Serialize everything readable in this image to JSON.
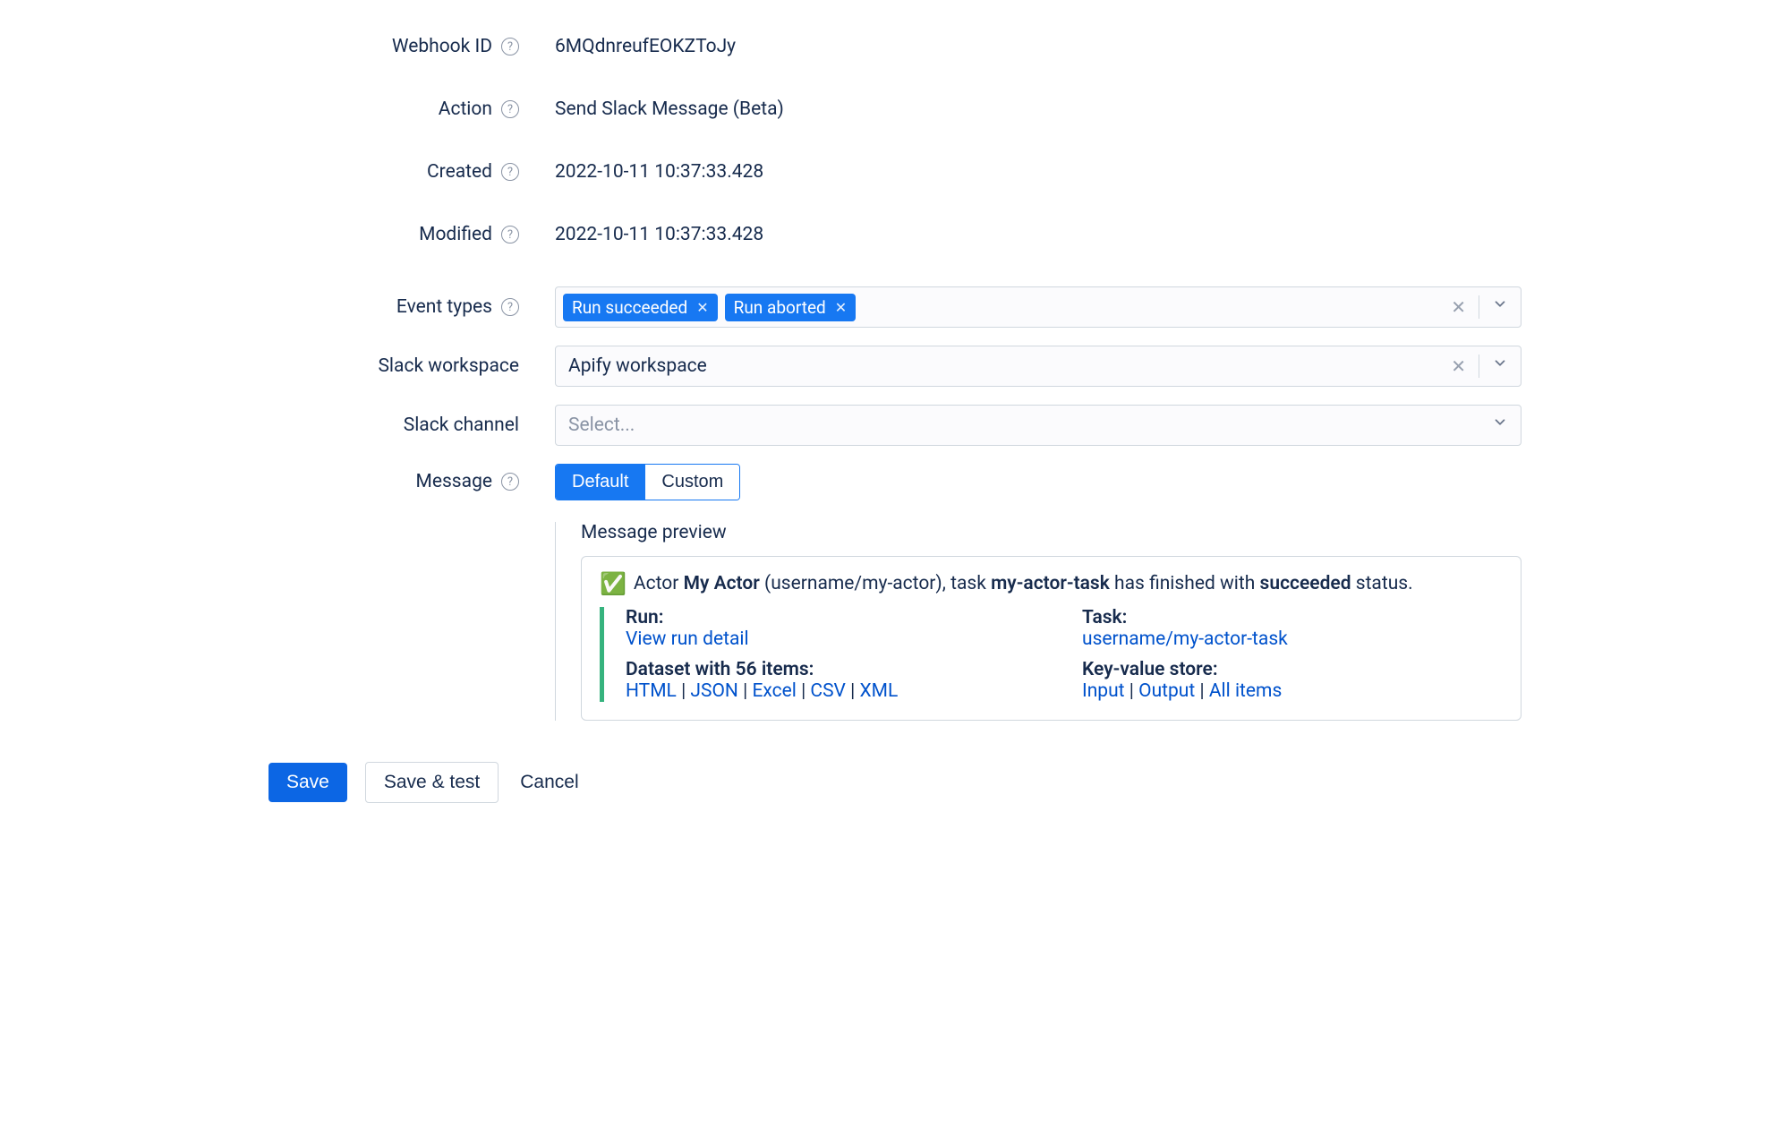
{
  "labels": {
    "webhook_id": "Webhook ID",
    "action": "Action",
    "created": "Created",
    "modified": "Modified",
    "event_types": "Event types",
    "slack_workspace": "Slack workspace",
    "slack_channel": "Slack channel",
    "message": "Message"
  },
  "values": {
    "webhook_id": "6MQdnreufEOKZToJy",
    "action": "Send Slack Message (Beta)",
    "created": "2022-10-11 10:37:33.428",
    "modified": "2022-10-11 10:37:33.428",
    "slack_workspace": "Apify workspace",
    "slack_channel_placeholder": "Select..."
  },
  "event_types": [
    {
      "label": "Run succeeded"
    },
    {
      "label": "Run aborted"
    }
  ],
  "message_toggle": {
    "default": "Default",
    "custom": "Custom",
    "active": "default"
  },
  "preview": {
    "title": "Message preview",
    "header": {
      "prefix": "Actor ",
      "actor_name": "My Actor",
      "actor_slug": " (username/my-actor), task ",
      "task_name": "my-actor-task",
      "mid": " has finished with ",
      "status": "succeeded",
      "suffix": " status."
    },
    "run_label": "Run:",
    "run_link": "View run detail",
    "dataset_label": "Dataset with 56 items:",
    "dataset_links": [
      "HTML",
      "JSON",
      "Excel",
      "CSV",
      "XML"
    ],
    "task_label": "Task:",
    "task_link": "username/my-actor-task",
    "kvs_label": "Key-value store:",
    "kvs_links": [
      "Input",
      "Output",
      "All items"
    ]
  },
  "footer": {
    "save": "Save",
    "save_test": "Save & test",
    "cancel": "Cancel"
  }
}
